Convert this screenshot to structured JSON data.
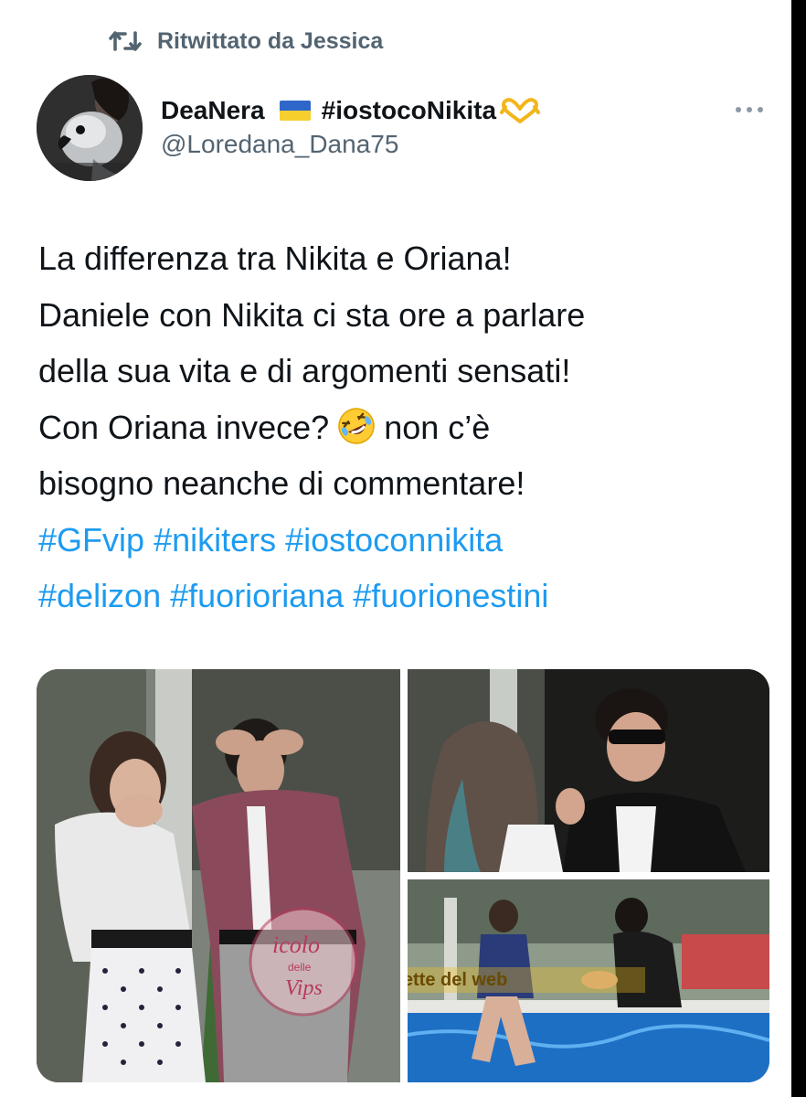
{
  "retweet": {
    "label": "Ritwittato da Jessica",
    "icon": "retweet-icon"
  },
  "author": {
    "display_name": "DeaNera",
    "flag_icon": "ukraine-flag-icon",
    "tag": "#iostocoNikita",
    "tag_emoji_icon": "heart-hands-icon",
    "handle": "@Loredana_Dana75",
    "avatar_icon": "avatar-parrot-image"
  },
  "more_icon": "more-options-icon",
  "tweet": {
    "line1": "La differenza tra Nikita e Oriana!",
    "line2": "Daniele con Nikita ci sta ore a parlare",
    "line3": "della sua vita e di argomenti sensati!",
    "line4_a": "Con Oriana invece?",
    "line4_emoji": "rolling-on-floor-laughing-emoji",
    "line4_b": "non c’è",
    "line5": "bisogno neanche di commentare!",
    "hashtags_line1": [
      "#GFvip",
      "#nikiters",
      "#iostoconnikita"
    ],
    "hashtags_line2": [
      "#delizon",
      "#fuorioriana",
      "#fuorionestini"
    ]
  },
  "media": {
    "watermark_left": [
      "icolo",
      "delle",
      "Vips"
    ],
    "watermark_right": "le tette del web"
  },
  "colors": {
    "text": "#0f1419",
    "secondary": "#536471",
    "link": "#1d9bf0",
    "background": "#ffffff"
  }
}
